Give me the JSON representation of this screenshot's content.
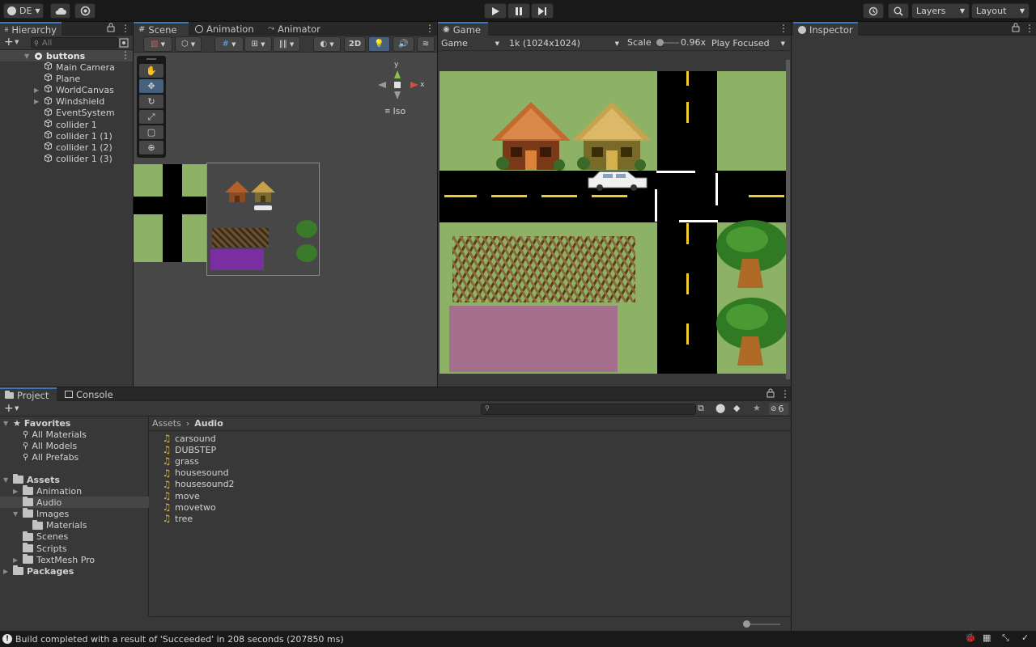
{
  "toolbar": {
    "account": "DE",
    "layers_label": "Layers",
    "layout_label": "Layout"
  },
  "hierarchy": {
    "tab": "Hierarchy",
    "search_placeholder": "All",
    "root": "buttons",
    "items": [
      "Main Camera",
      "Plane",
      "WorldCanvas",
      "Windshield",
      "EventSystem",
      "collider 1",
      "collider 1 (1)",
      "collider 1 (2)",
      "collider 1 (3)"
    ]
  },
  "scene": {
    "tabs": [
      "Scene",
      "Animation",
      "Animator"
    ],
    "btn_2d": "2D",
    "gizmo_x": "x",
    "gizmo_y": "y",
    "projection": "Iso"
  },
  "game": {
    "tab": "Game",
    "display": "Game",
    "resolution": "1k (1024x1024)",
    "scale_label": "Scale",
    "scale_value": "0.96x",
    "play_mode": "Play Focused"
  },
  "inspector": {
    "tab": "Inspector"
  },
  "project": {
    "tabs": [
      "Project",
      "Console"
    ],
    "favorites_label": "Favorites",
    "favorites": [
      "All Materials",
      "All Models",
      "All Prefabs"
    ],
    "assets_label": "Assets",
    "asset_folders": [
      "Animation",
      "Audio",
      "Images",
      "Materials",
      "Scenes",
      "Scripts",
      "TextMesh Pro"
    ],
    "packages_label": "Packages",
    "breadcrumb_root": "Assets",
    "breadcrumb_current": "Audio",
    "files": [
      "carsound",
      "DUBSTEP",
      "grass",
      "housesound",
      "housesound2",
      "move",
      "movetwo",
      "tree"
    ],
    "hidden_count": "6"
  },
  "status": {
    "message": "Build completed with a result of 'Succeeded' in 208 seconds (207850 ms)"
  },
  "colors": {
    "accent": "#3a79bb",
    "grass": "#8db165",
    "road": "#000000",
    "lane": "#f1cc2f",
    "purple": "#a46f8d"
  }
}
